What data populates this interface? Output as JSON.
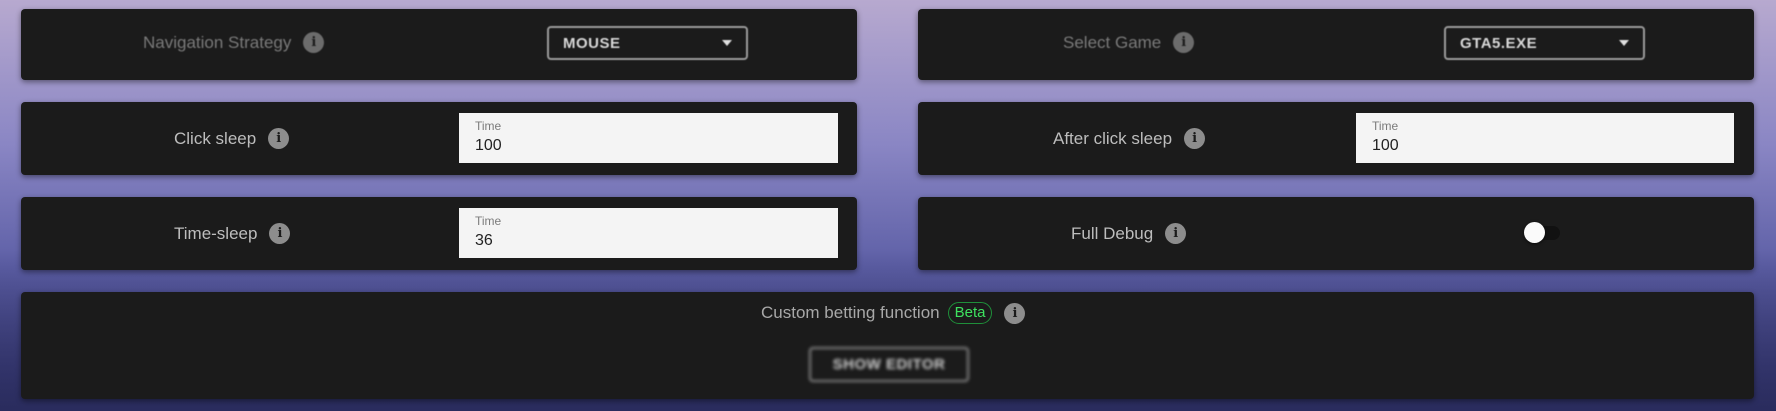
{
  "navigation": {
    "label": "Navigation Strategy",
    "value": "MOUSE"
  },
  "game": {
    "label": "Select Game",
    "value": "GTA5.EXE"
  },
  "click_sleep": {
    "label": "Click sleep",
    "field_label": "Time",
    "value": "100"
  },
  "after_click_sleep": {
    "label": "After click sleep",
    "field_label": "Time",
    "value": "100"
  },
  "time_sleep": {
    "label": "Time-sleep",
    "field_label": "Time",
    "value": "36"
  },
  "full_debug": {
    "label": "Full Debug",
    "enabled": false
  },
  "custom_betting": {
    "label": "Custom betting function",
    "badge": "Beta",
    "button": "SHOW EDITOR"
  },
  "icons": {
    "info": "info-icon",
    "dropdown": "caret-down-icon"
  },
  "colors": {
    "panel": "#1b1b1b",
    "beta": "#3ee25f",
    "field_bg": "#f4f4f4"
  }
}
